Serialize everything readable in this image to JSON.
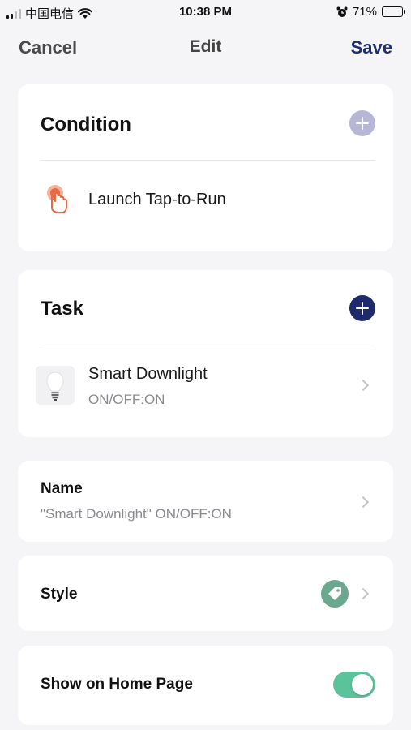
{
  "status_bar": {
    "carrier": "中国电信",
    "time": "10:38 PM",
    "battery_percent": "71%",
    "battery_level": 0.71
  },
  "nav": {
    "cancel_label": "Cancel",
    "title": "Edit",
    "save_label": "Save",
    "save_color": "#1f2f6b"
  },
  "condition": {
    "heading": "Condition",
    "item_label": "Launch Tap-to-Run",
    "item_icon": "tap-hand-icon"
  },
  "task": {
    "heading": "Task",
    "device_name": "Smart Downlight",
    "device_state": "ON/OFF:ON",
    "device_icon": "light-bulb-icon"
  },
  "name": {
    "label": "Name",
    "value": "\"Smart Downlight\" ON/OFF:ON"
  },
  "style": {
    "label": "Style",
    "icon": "tag-icon",
    "icon_color": "#6aa88f"
  },
  "home_page": {
    "label": "Show on Home Page",
    "enabled": true,
    "toggle_color": "#5ac39a"
  }
}
